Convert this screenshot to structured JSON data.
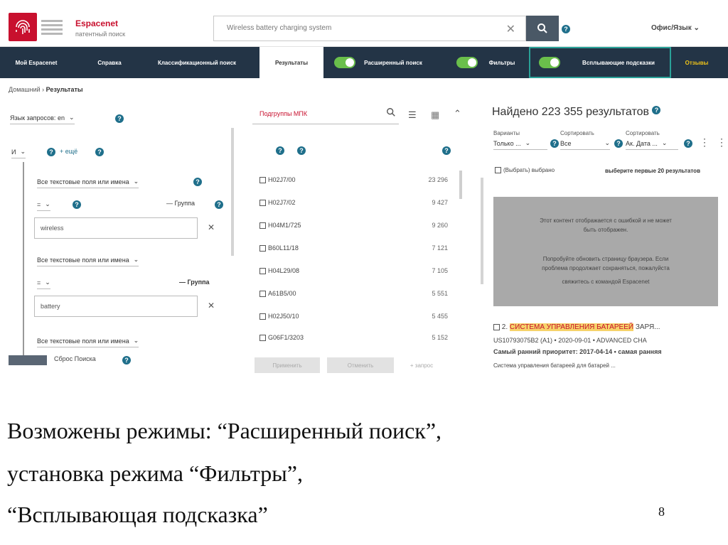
{
  "header": {
    "brand_name": "Espacenet",
    "brand_subtitle": "патентный поиск",
    "search_value": "Wireless battery charging system",
    "language_label": "Офис/Язык",
    "accent_red": "#c8102e",
    "nav_bg": "#233446",
    "toggle_green": "#6abf4b"
  },
  "nav": {
    "items": [
      {
        "label": "Мой Espacenet"
      },
      {
        "label": "Справка"
      },
      {
        "label": "Классификационный поиск"
      },
      {
        "label": "Результаты"
      },
      {
        "label": "Расширенный поиск"
      },
      {
        "label": "Фильтры"
      },
      {
        "label": "Всплывающие подсказки"
      },
      {
        "label": "Отзывы"
      }
    ]
  },
  "breadcrumb": {
    "home": "Домашний",
    "current": "Результаты"
  },
  "left_panel": {
    "query_language": "Язык запросов: en",
    "operator": "И",
    "add_more": "+ ещё",
    "field_type_1": "Все текстовые поля или имена",
    "field_type_2": "Все текстовые поля или имена",
    "field_type_3": "Все текстовые поля или имена",
    "group_label_1": "— Группа",
    "group_label_2": "— Группа",
    "eq_1": "=",
    "eq_2": "=",
    "value_1": "wireless",
    "value_2": "battery",
    "reset_label": "Сброс Поиска"
  },
  "middle_panel": {
    "filter_placeholder": "Подгруппы МПК",
    "rows": [
      {
        "code": "H02J7/00",
        "count": "23 296"
      },
      {
        "code": "H02J7/02",
        "count": "9 427"
      },
      {
        "code": "H04M1/725",
        "count": "9 260"
      },
      {
        "code": "B60L11/18",
        "count": "7 121"
      },
      {
        "code": "H04L29/08",
        "count": "7 105"
      },
      {
        "code": "A61B5/00",
        "count": "5 551"
      },
      {
        "code": "H02J50/10",
        "count": "5 455"
      },
      {
        "code": "G06F1/3203",
        "count": "5 152"
      }
    ],
    "apply_button": "Применить",
    "cancel_button": "Отменить",
    "more_button": "+ запрос"
  },
  "right_panel": {
    "found_text": "Найдено 223 355 результатов",
    "filter_1_label": "Варианты",
    "filter_1_value": "Только ...",
    "filter_2_label": "Сортировать",
    "filter_2_value": "Все",
    "filter_3_label": "Сортировать",
    "filter_3_value": "Ак. Дата ...",
    "select_all": "(Выбрать) выбрано",
    "select_first": "выберите первые 20 результатов",
    "error_line_1": "Этот контент отображается с ошибкой и не может",
    "error_line_2": "быть отображен.",
    "error_line_3": "Попробуйте обновить страницу браузера. Если",
    "error_line_4": "проблема продолжает сохраняться, пожалуйста",
    "error_line_5": "свяжитесь с командой Espacenet",
    "result_title_prefix": "2.",
    "result_title": "СИСТЕМА УПРАВЛЕНИЯ БАТАРЕЕЙ",
    "result_title_suffix": "ЗАРЯ...",
    "result_meta": "US10793075B2 (A1) • 2020-09-01 • ADVANCED CHA",
    "result_priority": "Самый ранний приоритет: 2017-04-14 • самая ранняя",
    "result_snippet": "Система управления батареей для батарей ..."
  },
  "slide": {
    "caption_line_1": "Возможены режимы: “Расширенный поиск”,",
    "caption_line_2": "установка режима “Фильтры”,",
    "caption_line_3": "“Всплывающая подсказка”",
    "page_number": "8"
  }
}
